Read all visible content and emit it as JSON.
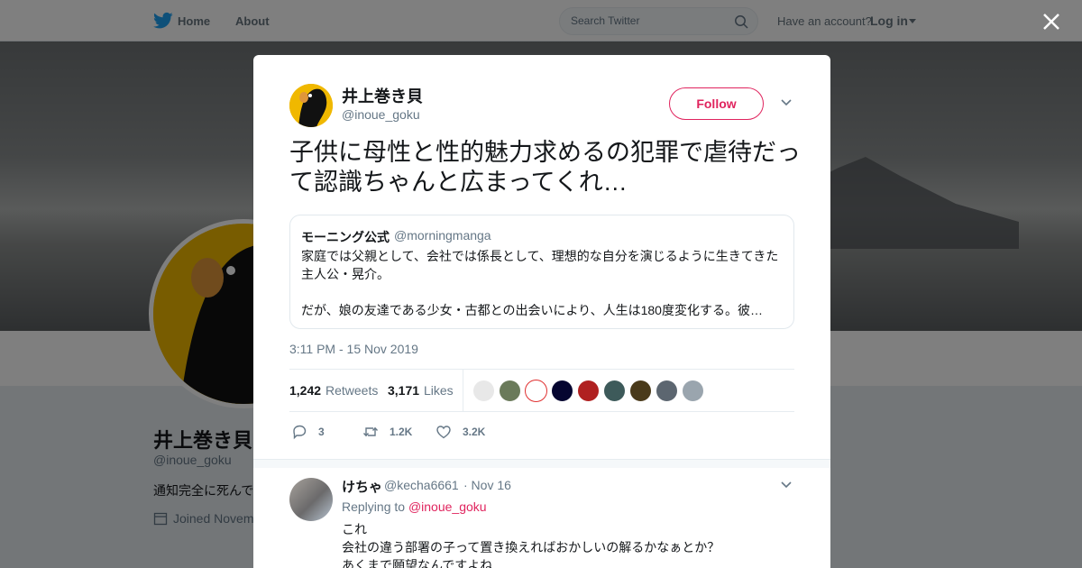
{
  "topbar": {
    "home_label": "Home",
    "about_label": "About",
    "search_placeholder": "Search Twitter",
    "have_account": "Have an account?",
    "login_label": "Log in"
  },
  "profile": {
    "name": "井上巻き貝",
    "handle": "@inoue_goku",
    "bio": "通知完全に死んで",
    "joined": "Joined Novem"
  },
  "tweet": {
    "name": "井上巻き貝",
    "handle": "@inoue_goku",
    "follow_label": "Follow",
    "text": "子供に母性と性的魅力求めるの犯罪で虐待だって認識ちゃんと広まってくれ…",
    "quote": {
      "name": "モーニング公式",
      "handle": "@morningmanga",
      "line1": "家庭では父親として、会社では係長として、理想的な自分を演じるように生きてきた主人公・晃介。",
      "line2": "だが、娘の友達である少女・古都との出会いにより、人生は180度変化する。彼…"
    },
    "timestamp": "3:11 PM - 15 Nov 2019",
    "retweets_count": "1,242",
    "retweets_label": "Retweets",
    "likes_count": "3,171",
    "likes_label": "Likes",
    "actions": {
      "reply": "3",
      "retweet": "1.2K",
      "like": "3.2K"
    }
  },
  "reply": {
    "name": "けちゃ",
    "handle": "@kecha6661",
    "date": "· Nov 16",
    "replying_prefix": "Replying to",
    "replying_to": "@inoue_goku",
    "line1": "これ",
    "line2": "会社の違う部署の子って置き換えればおかしいの解るかなぁとか？",
    "line3": "あくまで願望なんですよね"
  },
  "colors": {
    "accent": "#e0245e",
    "twitter_blue": "#1da1f2",
    "muted": "#657786"
  }
}
